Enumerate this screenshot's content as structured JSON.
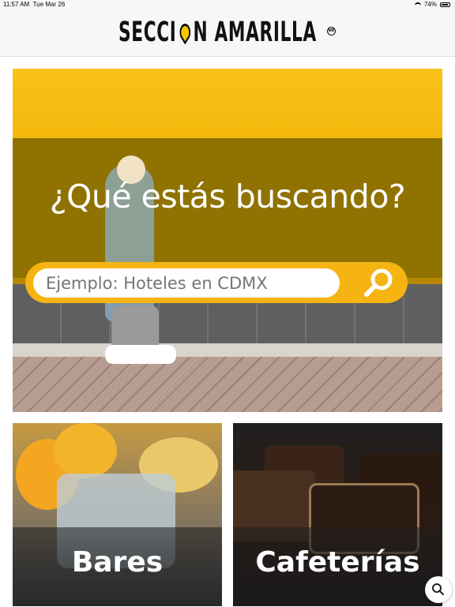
{
  "status_bar": {
    "time": "11:57 AM",
    "date": "Tue Mar 26",
    "battery": "74%"
  },
  "header": {
    "logo_part1": "SECCI",
    "logo_part2": "N AMARILLA",
    "reg_mark": "MR"
  },
  "hero": {
    "title": "¿Qué estás buscando?",
    "search_placeholder": "Ejemplo: Hoteles en CDMX"
  },
  "categories": [
    {
      "label": "Bares"
    },
    {
      "label": "Cafeterías"
    }
  ],
  "colors": {
    "brand_yellow": "#f5b412",
    "text_dark": "#111111"
  },
  "icons": {
    "search": "search-icon",
    "fab": "search-icon",
    "wifi": "wifi-icon",
    "battery": "battery-icon",
    "pin": "location-pin-icon"
  }
}
